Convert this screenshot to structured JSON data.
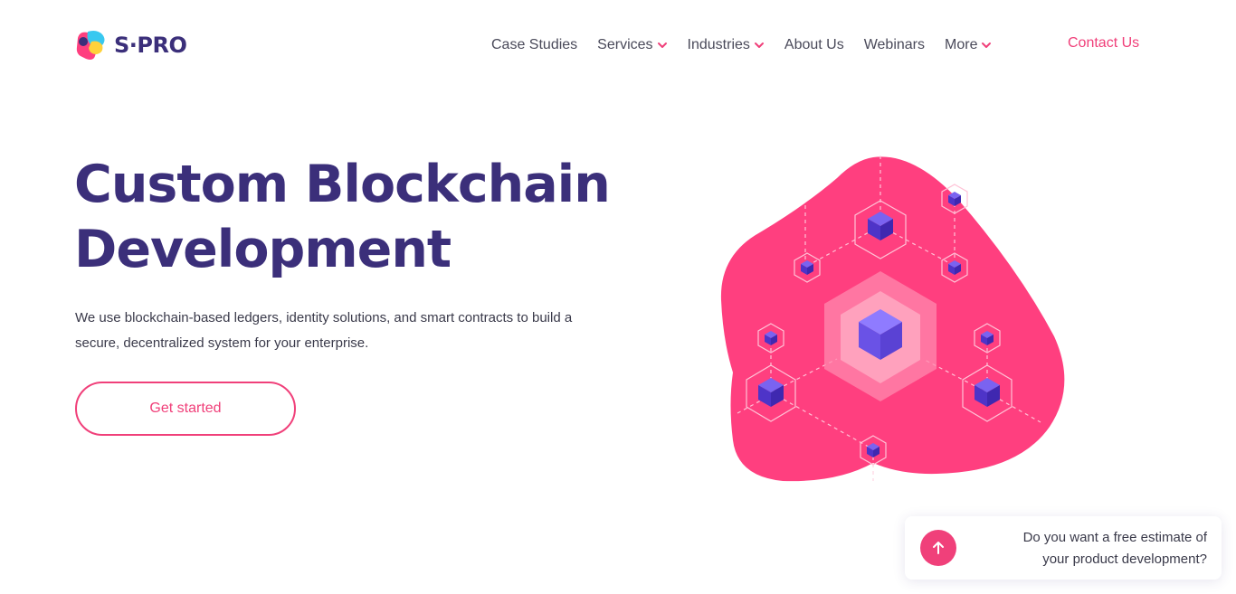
{
  "brand": {
    "name": "S·PRO",
    "accent": "#f0407a",
    "primary": "#3b2f7a"
  },
  "nav": {
    "items": [
      {
        "label": "Case Studies",
        "has_dropdown": false
      },
      {
        "label": "Services",
        "has_dropdown": true
      },
      {
        "label": "Industries",
        "has_dropdown": true
      },
      {
        "label": "About Us",
        "has_dropdown": false
      },
      {
        "label": "Webinars",
        "has_dropdown": false
      },
      {
        "label": "More",
        "has_dropdown": true
      }
    ],
    "contact_label": "Contact Us"
  },
  "hero": {
    "title_line1": "Custom Blockchain",
    "title_line2": "Development",
    "description": "We use blockchain-based ledgers, identity solutions, and smart contracts to build a secure, decentralized system for your enterprise.",
    "cta_label": "Get started"
  },
  "illustration": {
    "name": "blockchain-network-illustration",
    "blob_color": "#ff3f7f",
    "cube_color": "#5b3fd1"
  },
  "estimate_widget": {
    "line1": "Do you want a free estimate of",
    "line2": "your product development?",
    "icon": "arrow-up-icon"
  }
}
